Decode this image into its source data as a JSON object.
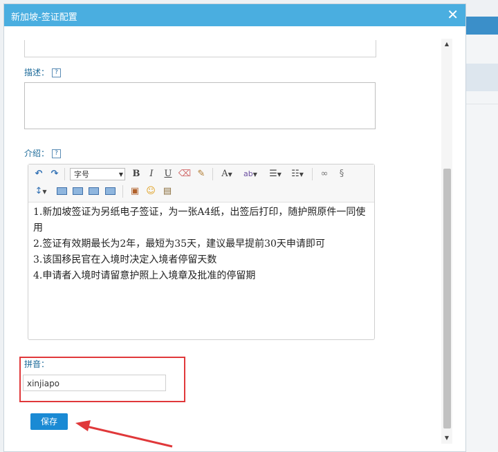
{
  "dialog": {
    "title": "新加坡-签证配置",
    "close_glyph": "✕"
  },
  "fields": {
    "description_label": "描述：",
    "intro_label": "介绍：",
    "pinyin_label": "拼音：",
    "pinyin_value": "xinjiapo",
    "help_glyph": "?"
  },
  "editor": {
    "font_size_select": "字号",
    "toolbar_labels": {
      "bold": "B",
      "italic": "I",
      "underline": "U",
      "font_color": "A",
      "highlight": "ab"
    },
    "content": [
      "1.新加坡签证为另纸电子签证，为一张A4纸，出签后打印，随护照原件一同使用",
      "2.签证有效期最长为2年，最短为35天，建议最早提前30天申请即可",
      "3.该国移民官在入境时决定入境者停留天数",
      "4.申请者入境时请留意护照上入境章及批准的停留期"
    ]
  },
  "buttons": {
    "save_label": "保存"
  },
  "colors": {
    "titlebar": "#4aaee0",
    "accent": "#1a8ad4",
    "highlight_box": "#e0383a",
    "label_text": "#1c6a99"
  },
  "icons": [
    "undo-icon",
    "redo-icon",
    "eraser-icon",
    "format-brush-icon",
    "ordered-list-icon",
    "unordered-list-icon",
    "link-icon",
    "unlink-icon",
    "line-height-icon",
    "align-left-icon",
    "align-center-icon",
    "align-right-icon",
    "justify-icon",
    "image-icon",
    "emoji-icon",
    "paste-icon"
  ]
}
